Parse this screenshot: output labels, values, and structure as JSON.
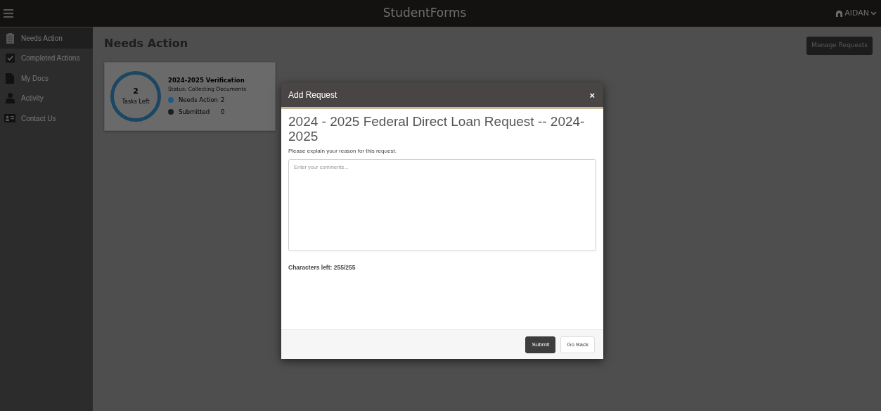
{
  "app": {
    "title": "StudentForms",
    "user": "AIDAN"
  },
  "sidebar": {
    "items": [
      {
        "label": "Needs Action",
        "selected": true
      },
      {
        "label": "Completed Actions",
        "selected": false
      },
      {
        "label": "My Docs",
        "selected": false
      },
      {
        "label": "Activity",
        "selected": false
      },
      {
        "label": "Contact Us",
        "selected": false
      }
    ]
  },
  "page": {
    "title": "Needs Action",
    "action_button": "Manage Requests"
  },
  "task_card": {
    "count": "2",
    "count_label": "Tasks Left",
    "title": "2024-2025 Verification",
    "status": "Status: Collecting Documents",
    "legend": [
      {
        "label": "Needs Action",
        "value": "2",
        "color": "#1d5a85"
      },
      {
        "label": "Submitted",
        "value": "0",
        "color": "#1e1e1e"
      }
    ]
  },
  "modal": {
    "title": "Add Request",
    "close": "×",
    "heading": "2024 - 2025 Federal Direct Loan Request -- 2024-2025",
    "prompt": "Please explain your reason for this request.",
    "placeholder": "Enter your comments...",
    "chars_left": "Characters left: 255/255",
    "buttons": [
      {
        "label": "Submit",
        "kind": "primary"
      },
      {
        "label": "Go Back",
        "kind": "secondary"
      }
    ]
  }
}
